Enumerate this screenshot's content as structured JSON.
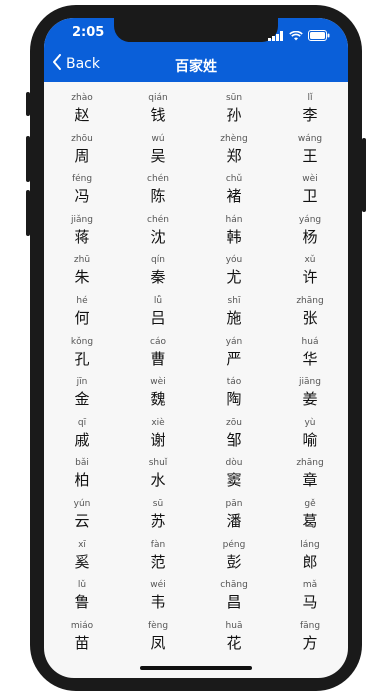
{
  "status_bar": {
    "time": "2:05"
  },
  "nav": {
    "back_label": "Back",
    "title": "百家姓"
  },
  "icons": {
    "back": "chevron-left-icon",
    "wifi": "wifi-icon",
    "battery": "battery-icon",
    "signal": "signal-icon"
  },
  "colors": {
    "header": "#0a5fd9",
    "background": "#f7f7f7"
  },
  "surnames": [
    {
      "pinyin": "zhào",
      "char": "赵"
    },
    {
      "pinyin": "qián",
      "char": "钱"
    },
    {
      "pinyin": "sūn",
      "char": "孙"
    },
    {
      "pinyin": "lǐ",
      "char": "李"
    },
    {
      "pinyin": "zhōu",
      "char": "周"
    },
    {
      "pinyin": "wú",
      "char": "吴"
    },
    {
      "pinyin": "zhèng",
      "char": "郑"
    },
    {
      "pinyin": "wáng",
      "char": "王"
    },
    {
      "pinyin": "féng",
      "char": "冯"
    },
    {
      "pinyin": "chén",
      "char": "陈"
    },
    {
      "pinyin": "chǔ",
      "char": "褚"
    },
    {
      "pinyin": "wèi",
      "char": "卫"
    },
    {
      "pinyin": "jiǎng",
      "char": "蒋"
    },
    {
      "pinyin": "chén",
      "char": "沈"
    },
    {
      "pinyin": "hán",
      "char": "韩"
    },
    {
      "pinyin": "yáng",
      "char": "杨"
    },
    {
      "pinyin": "zhū",
      "char": "朱"
    },
    {
      "pinyin": "qín",
      "char": "秦"
    },
    {
      "pinyin": "yóu",
      "char": "尤"
    },
    {
      "pinyin": "xǔ",
      "char": "许"
    },
    {
      "pinyin": "hé",
      "char": "何"
    },
    {
      "pinyin": "lǚ",
      "char": "吕"
    },
    {
      "pinyin": "shī",
      "char": "施"
    },
    {
      "pinyin": "zhāng",
      "char": "张"
    },
    {
      "pinyin": "kǒng",
      "char": "孔"
    },
    {
      "pinyin": "cáo",
      "char": "曹"
    },
    {
      "pinyin": "yán",
      "char": "严"
    },
    {
      "pinyin": "huá",
      "char": "华"
    },
    {
      "pinyin": "jīn",
      "char": "金"
    },
    {
      "pinyin": "wèi",
      "char": "魏"
    },
    {
      "pinyin": "táo",
      "char": "陶"
    },
    {
      "pinyin": "jiāng",
      "char": "姜"
    },
    {
      "pinyin": "qī",
      "char": "戚"
    },
    {
      "pinyin": "xiè",
      "char": "谢"
    },
    {
      "pinyin": "zōu",
      "char": "邹"
    },
    {
      "pinyin": "yù",
      "char": "喻"
    },
    {
      "pinyin": "bǎi",
      "char": "柏"
    },
    {
      "pinyin": "shuǐ",
      "char": "水"
    },
    {
      "pinyin": "dòu",
      "char": "窦"
    },
    {
      "pinyin": "zhāng",
      "char": "章"
    },
    {
      "pinyin": "yún",
      "char": "云"
    },
    {
      "pinyin": "sū",
      "char": "苏"
    },
    {
      "pinyin": "pān",
      "char": "潘"
    },
    {
      "pinyin": "gě",
      "char": "葛"
    },
    {
      "pinyin": "xī",
      "char": "奚"
    },
    {
      "pinyin": "fàn",
      "char": "范"
    },
    {
      "pinyin": "péng",
      "char": "彭"
    },
    {
      "pinyin": "láng",
      "char": "郎"
    },
    {
      "pinyin": "lǔ",
      "char": "鲁"
    },
    {
      "pinyin": "wéi",
      "char": "韦"
    },
    {
      "pinyin": "chāng",
      "char": "昌"
    },
    {
      "pinyin": "mǎ",
      "char": "马"
    },
    {
      "pinyin": "miáo",
      "char": "苗"
    },
    {
      "pinyin": "fèng",
      "char": "凤"
    },
    {
      "pinyin": "huā",
      "char": "花"
    },
    {
      "pinyin": "fāng",
      "char": "方"
    }
  ]
}
